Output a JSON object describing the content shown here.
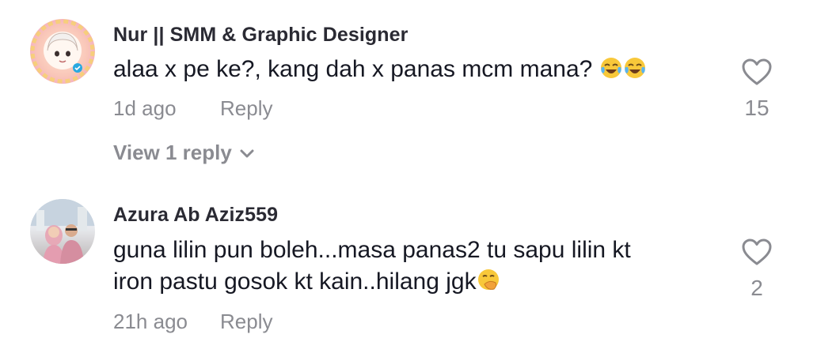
{
  "comments": [
    {
      "username": "Nur || SMM & Graphic Designer",
      "text": "alaa x pe ke?, kang dah x panas mcm mana? ",
      "emoji_icons": [
        "face-with-tears-of-joy-icon",
        "face-with-tears-of-joy-icon"
      ],
      "time": "1d ago",
      "reply_label": "Reply",
      "likes": "15",
      "view_replies_label": "View 1 reply"
    },
    {
      "username": "Azura Ab Aziz559",
      "text_line1": "guna lilin pun boleh...masa panas2 tu sapu lilin kt",
      "text_line2": "iron pastu gosok kt kain..hilang jgk",
      "emoji_icons": [
        "face-with-hand-over-mouth-icon"
      ],
      "time": "21h ago",
      "reply_label": "Reply",
      "likes": "2"
    }
  ],
  "colors": {
    "primary_text": "#161823",
    "secondary_text": "#8a8b91",
    "icon_gray": "#8a8b91"
  }
}
